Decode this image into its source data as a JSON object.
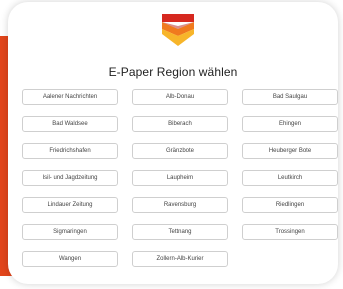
{
  "colors": {
    "accent": "#e2451b",
    "logo_red": "#d6281f",
    "logo_orange": "#f07a1e",
    "logo_yellow": "#f7b52a"
  },
  "logo": {
    "icon": "newspaper-shield-logo"
  },
  "title": "E-Paper Region wählen",
  "regions": [
    "Aalener Nachrichten",
    "Alb-Donau",
    "Bad Saulgau",
    "Bad Waldsee",
    "Biberach",
    "Ehingen",
    "Friedrichshafen",
    "Gränzbote",
    "Heuberger Bote",
    "Isil- und Jagdzeitung",
    "Laupheim",
    "Leutkirch",
    "Lindauer Zeitung",
    "Ravensburg",
    "Riedlingen",
    "Sigmaringen",
    "Tettnang",
    "Trossingen",
    "Wangen",
    "Zollern-Alb-Kurier"
  ]
}
